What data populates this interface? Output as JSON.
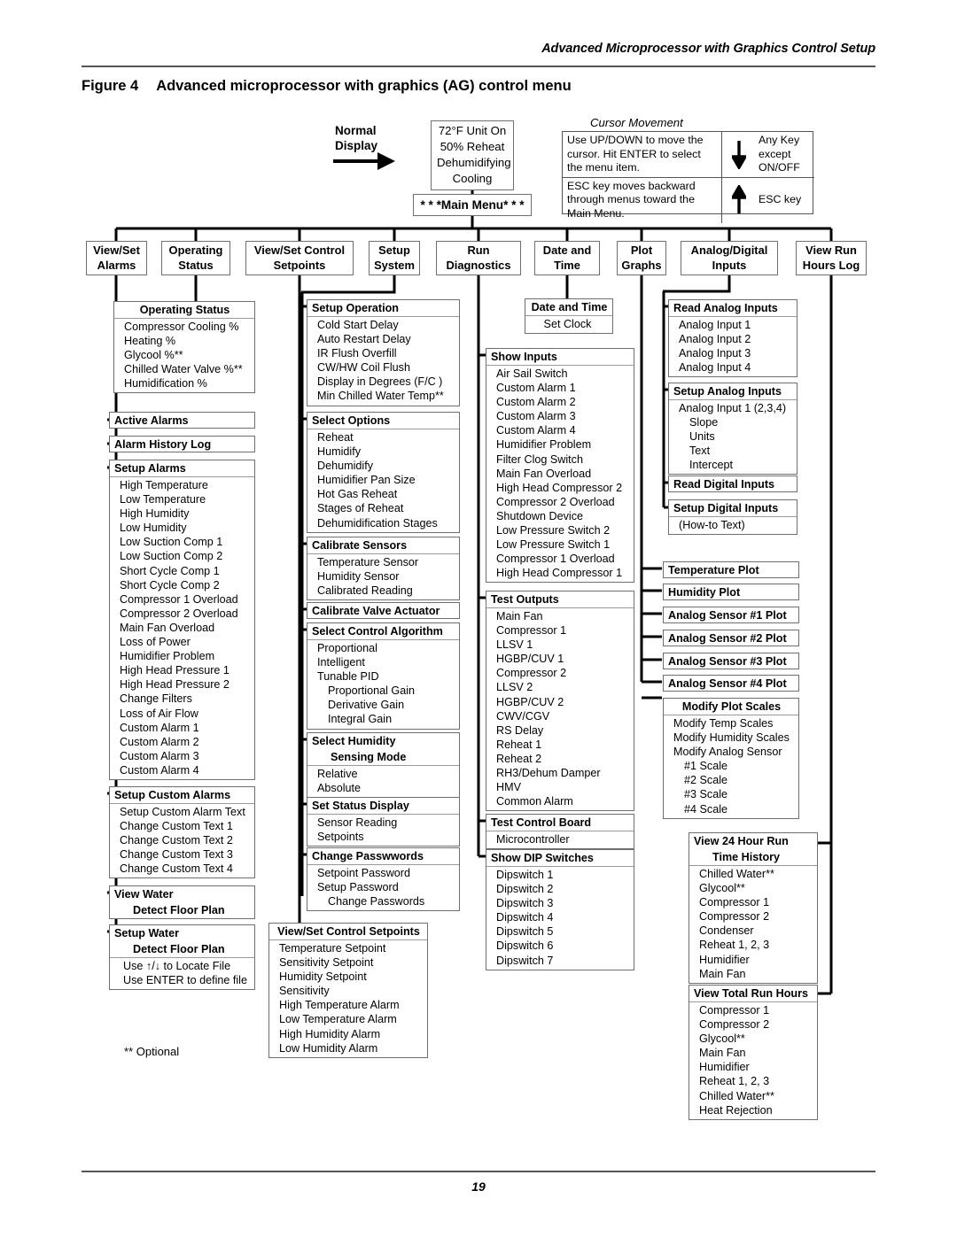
{
  "page": {
    "running_head": "Advanced Microprocessor with Graphics Control Setup",
    "figure_label": "Figure 4",
    "figure_title": "Advanced microprocessor with graphics (AG) control menu",
    "page_number": "19",
    "footnote": "** Optional"
  },
  "top": {
    "normal_display_label": "Normal\nDisplay",
    "normal_display_line1": "Normal",
    "normal_display_line2": "Display",
    "status_display": [
      "72°F Unit On",
      "50% Reheat",
      "Dehumidifying",
      "Cooling"
    ],
    "main_menu_label": "* * *Main Menu* * *",
    "cursor_movement_title": "Cursor Movement",
    "cursor_rows": [
      {
        "text": "Use UP/DOWN to move the cursor. Hit ENTER to select the menu item.",
        "arrow": "down",
        "key": "Any Key except ON/OFF"
      },
      {
        "text": "ESC key moves backward through menus toward the Main Menu.",
        "arrow": "up",
        "key": "ESC key"
      }
    ]
  },
  "menu_bar": [
    {
      "line1": "View/Set",
      "line2": "Alarms"
    },
    {
      "line1": "Operating",
      "line2": "Status"
    },
    {
      "line1": "View/Set Control",
      "line2": "Setpoints"
    },
    {
      "line1": "Setup",
      "line2": "System"
    },
    {
      "line1": "Run",
      "line2": "Diagnostics"
    },
    {
      "line1": "Date and",
      "line2": "Time"
    },
    {
      "line1": "Plot",
      "line2": "Graphs"
    },
    {
      "line1": "Analog/Digital",
      "line2": "Inputs"
    },
    {
      "line1": "View Run",
      "line2": "Hours Log"
    }
  ],
  "columns": {
    "operating_status": {
      "title": "Operating Status",
      "items": [
        "Compressor Cooling %",
        "Heating %",
        "Glycool %**",
        "Chilled Water Valve %**",
        "Humidification %"
      ]
    },
    "active_alarms": {
      "title": "Active Alarms"
    },
    "alarm_history_log": {
      "title": "Alarm History Log"
    },
    "setup_alarms": {
      "title": "Setup Alarms",
      "items": [
        "High Temperature",
        "Low Temperature",
        "High Humidity",
        "Low Humidity",
        "Low Suction Comp 1",
        "Low Suction Comp 2",
        "Short Cycle Comp 1",
        "Short Cycle Comp 2",
        "Compressor 1 Overload",
        "Compressor 2 Overload",
        "Main Fan Overload",
        "Loss of Power",
        "Humidifier Problem",
        "High Head Pressure 1",
        "High Head Pressure 2",
        "Change Filters",
        "Loss of Air Flow",
        "Custom Alarm 1",
        "Custom Alarm 2",
        "Custom Alarm 3",
        "Custom Alarm 4"
      ]
    },
    "setup_custom_alarms": {
      "title": "Setup Custom Alarms",
      "items": [
        "Setup Custom Alarm Text",
        "Change Custom Text 1",
        "Change Custom Text 2",
        "Change Custom Text 3",
        "Change Custom Text 4"
      ]
    },
    "view_water": {
      "title_line1": "View Water",
      "title_line2": "Detect Floor Plan"
    },
    "setup_water": {
      "title_line1": "Setup Water",
      "title_line2": "Detect Floor Plan",
      "items": [
        "Use ↑/↓ to Locate File",
        "Use ENTER to define file"
      ]
    },
    "setup_operation": {
      "title": "Setup Operation",
      "items": [
        "Cold Start Delay",
        "Auto Restart Delay",
        "IR Flush Overfill",
        "CW/HW Coil Flush",
        "Display in Degrees (F/C )",
        "Min Chilled Water Temp**"
      ]
    },
    "select_options": {
      "title": "Select Options",
      "items": [
        "Reheat",
        "Humidify",
        "Dehumidify",
        "Humidifier Pan Size",
        "Hot Gas Reheat",
        "Stages of Reheat",
        "Dehumidification Stages"
      ]
    },
    "calibrate_sensors": {
      "title": "Calibrate Sensors",
      "items": [
        "Temperature Sensor",
        "Humidity Sensor",
        "Calibrated Reading"
      ]
    },
    "calibrate_valve_actuator": {
      "title": "Calibrate Valve Actuator"
    },
    "select_control_algorithm": {
      "title": "Select Control Algorithm",
      "items": [
        "Proportional",
        "Intelligent",
        "Tunable PID",
        "Proportional Gain",
        "Derivative Gain",
        "Integral Gain"
      ]
    },
    "select_humidity": {
      "title_line1": "Select Humidity",
      "title_line2": "Sensing Mode",
      "items": [
        "Relative",
        "Absolute"
      ]
    },
    "set_status_display": {
      "title": "Set Status Display",
      "items": [
        "Sensor Reading",
        "Setpoints"
      ]
    },
    "change_passwords": {
      "title": "Change Passwwords",
      "items": [
        "Setpoint Password",
        "Setup Password",
        "Change Passwords"
      ]
    },
    "view_set_control_setpoints": {
      "title": "View/Set Control Setpoints",
      "items": [
        "Temperature Setpoint",
        "Sensitivity Setpoint",
        "Humidity Setpoint",
        "Sensitivity",
        "High Temperature Alarm",
        "Low Temperature Alarm",
        "High Humidity Alarm",
        "Low Humidity Alarm"
      ]
    },
    "date_and_time": {
      "title": "Date and Time",
      "items": [
        "Set Clock"
      ]
    },
    "show_inputs": {
      "title": "Show Inputs",
      "items": [
        "Air Sail Switch",
        "Custom Alarm 1",
        "Custom Alarm 2",
        "Custom Alarm 3",
        "Custom Alarm 4",
        "Humidifier Problem",
        "Filter Clog Switch",
        "Main Fan Overload",
        "High Head Compressor 2",
        "Compressor 2 Overload",
        "Shutdown Device",
        "Low Pressure Switch 2",
        "Low Pressure Switch 1",
        "Compressor 1 Overload",
        "High Head Compressor 1"
      ]
    },
    "test_outputs": {
      "title": "Test Outputs",
      "items": [
        "Main Fan",
        "Compressor 1",
        "LLSV 1",
        "HGBP/CUV 1",
        "Compressor 2",
        "LLSV 2",
        "HGBP/CUV 2",
        "CWV/CGV",
        "RS Delay",
        "Reheat 1",
        "Reheat 2",
        "RH3/Dehum Damper",
        "HMV",
        "Common Alarm"
      ]
    },
    "test_control_board": {
      "title": "Test Control Board",
      "items": [
        "Microcontroller"
      ]
    },
    "show_dip_switches": {
      "title": "Show DIP Switches",
      "items": [
        "Dipswitch 1",
        "Dipswitch 2",
        "Dipswitch 3",
        "Dipswitch 4",
        "Dipswitch 5",
        "Dipswitch 6",
        "Dipswitch 7"
      ]
    },
    "read_analog_inputs": {
      "title": "Read Analog Inputs",
      "items": [
        "Analog Input 1",
        "Analog Input 2",
        "Analog Input 3",
        "Analog Input 4"
      ]
    },
    "setup_analog_inputs": {
      "title": "Setup Analog Inputs",
      "items": [
        "Analog Input 1 (2,3,4)",
        "Slope",
        "Units",
        "Text",
        "Intercept"
      ]
    },
    "read_digital_inputs": {
      "title": "Read Digital Inputs"
    },
    "setup_digital_inputs": {
      "title": "Setup Digital Inputs",
      "items": [
        "(How-to Text)"
      ]
    },
    "temperature_plot": {
      "title": "Temperature Plot"
    },
    "humidity_plot": {
      "title": "Humidity Plot"
    },
    "analog_sensor_1_plot": {
      "title": "Analog Sensor #1 Plot"
    },
    "analog_sensor_2_plot": {
      "title": "Analog Sensor #2 Plot"
    },
    "analog_sensor_3_plot": {
      "title": "Analog Sensor #3 Plot"
    },
    "analog_sensor_4_plot": {
      "title": "Analog Sensor #4 Plot"
    },
    "modify_plot_scales": {
      "title": "Modify Plot Scales",
      "items": [
        "Modify Temp Scales",
        "Modify Humidity Scales",
        "Modify Analog Sensor",
        "#1 Scale",
        "#2 Scale",
        "#3 Scale",
        "#4 Scale"
      ]
    },
    "view_24_hour_run": {
      "title_line1": "View 24 Hour Run",
      "title_line2": "Time History",
      "items": [
        "Chilled Water**",
        "Glycool**",
        "Compressor 1",
        "Compressor 2",
        "Condenser",
        "Reheat 1, 2, 3",
        "Humidifier",
        "Main Fan"
      ]
    },
    "view_total_run_hours": {
      "title": "View Total Run Hours",
      "items": [
        "Compressor 1",
        "Compressor 2",
        "Glycool**",
        "Main Fan",
        "Humidifier",
        "Reheat 1, 2, 3",
        "Chilled Water**",
        "Heat Rejection"
      ]
    }
  }
}
